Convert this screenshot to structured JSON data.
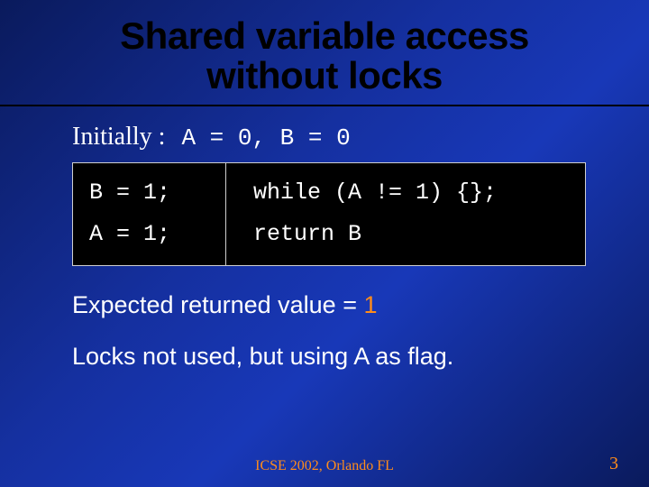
{
  "title_line1": "Shared variable access",
  "title_line2": "without locks",
  "initial": {
    "label": "Initially :",
    "code": "A = 0, B = 0"
  },
  "code_box": {
    "left": [
      "B = 1;",
      "A = 1;"
    ],
    "right": [
      "while (A != 1) {};",
      "return B"
    ]
  },
  "expected_prefix": "Expected  returned value = ",
  "expected_value": "1",
  "flag_line": "Locks not used, but using A as flag.",
  "footer": "ICSE 2002, Orlando FL",
  "page_number": "3"
}
